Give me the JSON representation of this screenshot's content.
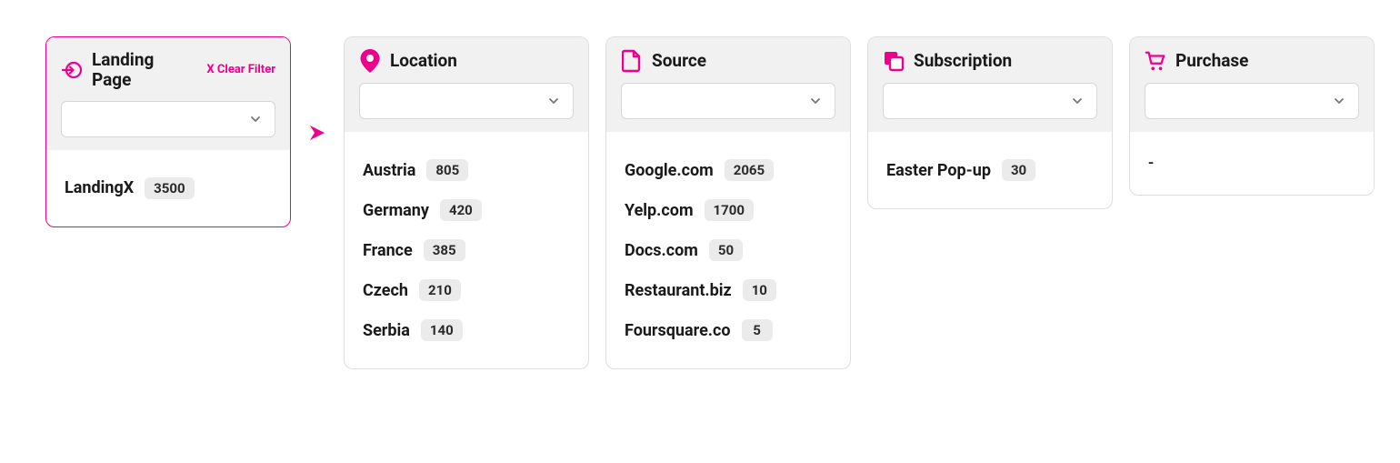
{
  "clear_filter_label": "X Clear Filter",
  "placeholder_dash": "-",
  "cards": [
    {
      "title": "Landing Page",
      "icon": "enter-icon",
      "active": true,
      "has_clear": true,
      "items": [
        {
          "label": "LandingX",
          "count": "3500"
        }
      ],
      "placeholder": null
    },
    {
      "title": "Location",
      "icon": "location-pin-icon",
      "active": false,
      "has_clear": false,
      "items": [
        {
          "label": "Austria",
          "count": "805"
        },
        {
          "label": "Germany",
          "count": "420"
        },
        {
          "label": "France",
          "count": "385"
        },
        {
          "label": "Czech",
          "count": "210"
        },
        {
          "label": "Serbia",
          "count": "140"
        }
      ],
      "placeholder": null
    },
    {
      "title": "Source",
      "icon": "file-icon",
      "active": false,
      "has_clear": false,
      "items": [
        {
          "label": "Google.com",
          "count": "2065"
        },
        {
          "label": "Yelp.com",
          "count": "1700"
        },
        {
          "label": "Docs.com",
          "count": "50"
        },
        {
          "label": "Restaurant.biz",
          "count": "10"
        },
        {
          "label": "Foursquare.co",
          "count": "5"
        }
      ],
      "placeholder": null
    },
    {
      "title": "Subscription",
      "icon": "copy-icon",
      "active": false,
      "has_clear": false,
      "items": [
        {
          "label": "Easter Pop-up",
          "count": "30"
        }
      ],
      "placeholder": null
    },
    {
      "title": "Purchase",
      "icon": "cart-icon",
      "active": false,
      "has_clear": false,
      "items": [],
      "placeholder": "-"
    }
  ]
}
